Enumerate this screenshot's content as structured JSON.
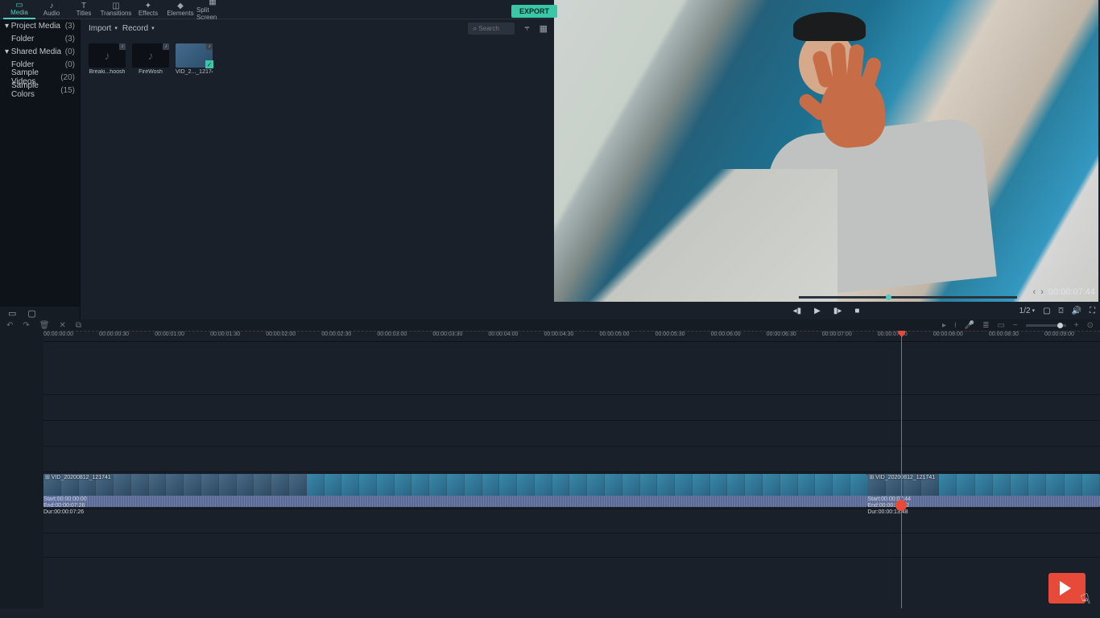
{
  "tabs": [
    {
      "label": "Media",
      "icon": "folder-icon"
    },
    {
      "label": "Audio",
      "icon": "audio-icon"
    },
    {
      "label": "Titles",
      "icon": "titles-icon"
    },
    {
      "label": "Transitions",
      "icon": "transitions-icon"
    },
    {
      "label": "Effects",
      "icon": "effects-icon"
    },
    {
      "label": "Elements",
      "icon": "elements-icon"
    },
    {
      "label": "Split Screen",
      "icon": "splitscreen-icon"
    }
  ],
  "export_label": "EXPORT",
  "sidebar": [
    {
      "label": "Project Media",
      "count": "(3)",
      "child": false,
      "exp": true
    },
    {
      "label": "Folder",
      "count": "(3)",
      "child": true,
      "exp": false
    },
    {
      "label": "Shared Media",
      "count": "(0)",
      "child": false,
      "exp": true
    },
    {
      "label": "Folder",
      "count": "(0)",
      "child": true,
      "exp": false
    },
    {
      "label": "Sample Videos",
      "count": "(20)",
      "child": true,
      "exp": false
    },
    {
      "label": "Sample Colors",
      "count": "(15)",
      "child": true,
      "exp": false
    }
  ],
  "mediabar": {
    "import": "Import",
    "record": "Record",
    "search_placeholder": "Search"
  },
  "thumbs": [
    {
      "name": "Breaki...hoosh",
      "audio": true
    },
    {
      "name": "FireWosh",
      "audio": true
    },
    {
      "name": "VID_2..._121741",
      "audio": false,
      "video": true,
      "check": true
    }
  ],
  "preview": {
    "time": "00:00:07:44",
    "fraction": "1/2"
  },
  "ruler": [
    "00:00:00:00",
    "00:00:00:30",
    "00:00:01:00",
    "00:00:01:30",
    "00:00:02:00",
    "00:00:02:30",
    "00:00:03:00",
    "00:00:03:30",
    "00:00:04:00",
    "00:00:04:30",
    "00:00:05:00",
    "00:00:05:30",
    "00:00:06:00",
    "00:00:06:30",
    "00:00:07:00",
    "00:00:07:30",
    "00:00:08:00",
    "00:00:08:30",
    "00:00:09:00"
  ],
  "clips": {
    "a": {
      "title": "VID_20200812_121741",
      "start": "Start:00:00:00:00",
      "end": "End:00:00:07:26",
      "dur": "Dur:00:00:07:26"
    },
    "b": {
      "title": "VID_20200812_121741",
      "start": "Start:00:00:07:44",
      "end": "End:00:00:21:32",
      "dur": "Dur:00:00:13:48"
    }
  },
  "playhead_pct": 81.2
}
